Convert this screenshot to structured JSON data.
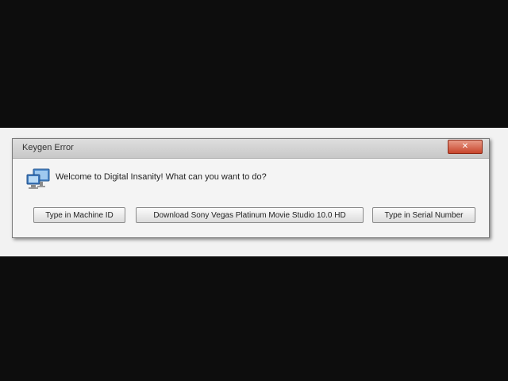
{
  "dialog": {
    "title": "Keygen Error",
    "close_label": "✕",
    "message": "Welcome to Digital Insanity! What can you want to do?",
    "icon": "computer-network-icon",
    "buttons": {
      "machine_id": "Type in Machine ID",
      "download": "Download Sony Vegas Platinum Movie Studio 10.0 HD",
      "serial": "Type in Serial Number"
    }
  },
  "colors": {
    "background": "#0d0d0d",
    "band": "#f2f2f2",
    "close_button": "#c8452c"
  }
}
